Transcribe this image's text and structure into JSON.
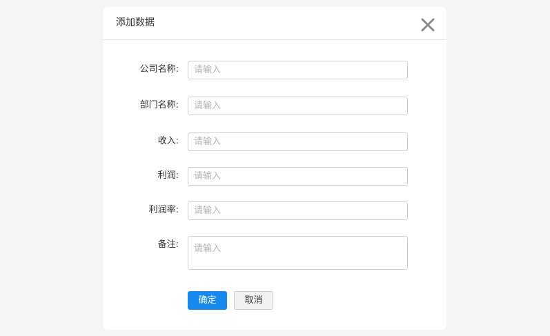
{
  "dialog": {
    "title": "添加数据",
    "close_icon": "close-icon"
  },
  "form": {
    "fields": [
      {
        "label": "公司名称:",
        "placeholder": "请输入",
        "value": ""
      },
      {
        "label": "部门名称:",
        "placeholder": "请输入",
        "value": ""
      },
      {
        "label": "收入:",
        "placeholder": "请输入",
        "value": ""
      },
      {
        "label": "利润:",
        "placeholder": "请输入",
        "value": ""
      },
      {
        "label": "利润率:",
        "placeholder": "请输入",
        "value": ""
      },
      {
        "label": "备注:",
        "placeholder": "请输入",
        "value": ""
      }
    ],
    "confirm_label": "确定",
    "cancel_label": "取消"
  },
  "colors": {
    "primary": "#1589ee",
    "background": "#f5f5f5"
  }
}
